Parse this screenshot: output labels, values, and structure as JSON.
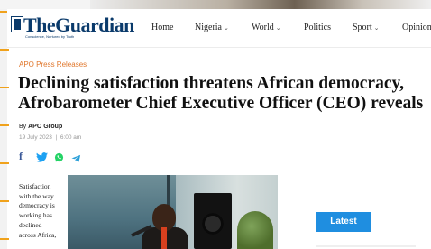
{
  "header": {
    "logo_text": "TheGuardian",
    "logo_tagline": "Conscience, Nurtured by Truth",
    "nav": [
      "Home",
      "Nigeria",
      "World",
      "Politics",
      "Sport",
      "Opinion"
    ]
  },
  "article": {
    "category": "APO Press Releases",
    "headline_line1": "Declining satisfaction threatens African democracy,",
    "headline_line2": "Afrobarometer Chief Executive Officer (CEO) reveals",
    "byline_prefix": "By",
    "author": "APO Group",
    "date": "19 July 2023",
    "separator": "|",
    "time": "6:00 am",
    "body_lines": [
      "Satisfaction",
      "with the way",
      "democracy is",
      "working has",
      "declined",
      "across Africa,"
    ]
  },
  "share": [
    "facebook-icon",
    "twitter-icon",
    "whatsapp-icon",
    "telegram-icon"
  ],
  "sidebar": {
    "latest_label": "Latest"
  },
  "colors": {
    "brand": "#0a3a6b",
    "category": "#e0772c",
    "accent": "#1f8ee0",
    "ticks": "#f0a21c"
  }
}
